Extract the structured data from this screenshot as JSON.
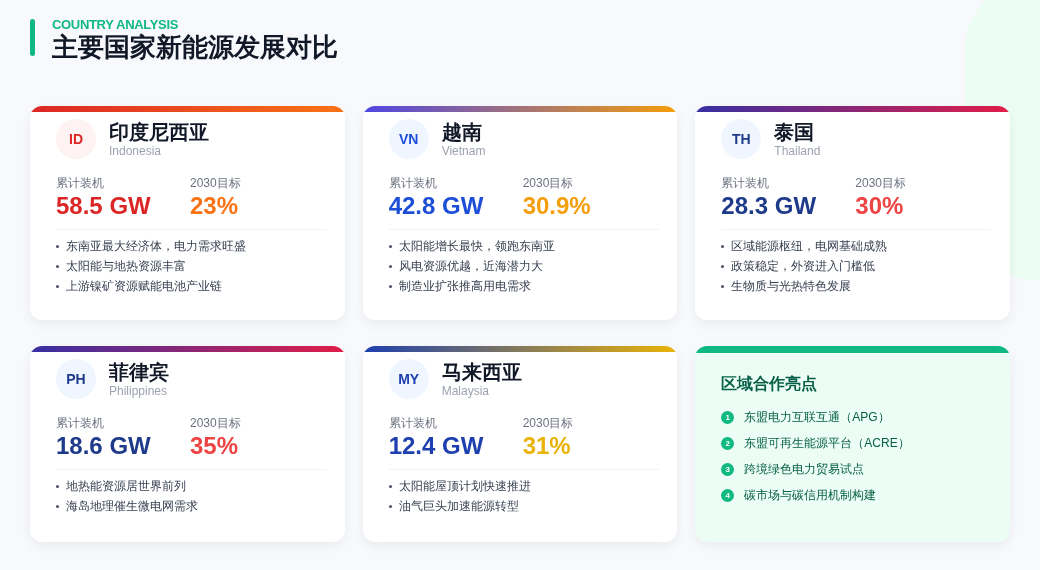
{
  "header": {
    "eyebrow": "COUNTRY ANALYSIS",
    "title": "主要国家新能源发展对比"
  },
  "countries": [
    {
      "code": "ID",
      "name": "印度尼西亚",
      "english": "Indonesia",
      "kind": "red",
      "capacity_label": "累计装机",
      "capacity": "58.5 GW",
      "target_label": "2030目标",
      "target": "23%",
      "points": [
        "东南亚最大经济体，电力需求旺盛",
        "太阳能与地热资源丰富",
        "上游镍矿资源赋能电池产业链"
      ]
    },
    {
      "code": "VN",
      "name": "越南",
      "english": "Vietnam",
      "kind": "blue-amber",
      "capacity_label": "累计装机",
      "capacity": "42.8 GW",
      "target_label": "2030目标",
      "target": "30.9%",
      "points": [
        "太阳能增长最快，领跑东南亚",
        "风电资源优越，近海潜力大",
        "制造业扩张推高用电需求"
      ]
    },
    {
      "code": "TH",
      "name": "泰国",
      "english": "Thailand",
      "kind": "indigo-rose",
      "capacity_label": "累计装机",
      "capacity": "28.3 GW",
      "target_label": "2030目标",
      "target": "30%",
      "points": [
        "区域能源枢纽，电网基础成熟",
        "政策稳定，外资进入门槛低",
        "生物质与光热特色发展"
      ]
    },
    {
      "code": "PH",
      "name": "菲律宾",
      "english": "Philippines",
      "kind": "indigo-rose",
      "capacity_label": "累计装机",
      "capacity": "18.6 GW",
      "target_label": "2030目标",
      "target": "35%",
      "points": [
        "地热能资源居世界前列",
        "海岛地理催生微电网需求"
      ]
    },
    {
      "code": "MY",
      "name": "马来西亚",
      "english": "Malaysia",
      "kind": "blue-gold",
      "capacity_label": "累计装机",
      "capacity": "12.4 GW",
      "target_label": "2030目标",
      "target": "31%",
      "points": [
        "太阳能屋顶计划快速推进",
        "油气巨头加速能源转型"
      ]
    }
  ],
  "highlights": {
    "title": "区域合作亮点",
    "items": [
      {
        "number": "1",
        "text": "东盟电力互联互通（APG）"
      },
      {
        "number": "2",
        "text": "东盟可再生能源平台（ACRE）"
      },
      {
        "number": "3",
        "text": "跨境绿色电力贸易试点"
      },
      {
        "number": "4",
        "text": "碳市场与碳信用机制构建"
      }
    ]
  }
}
